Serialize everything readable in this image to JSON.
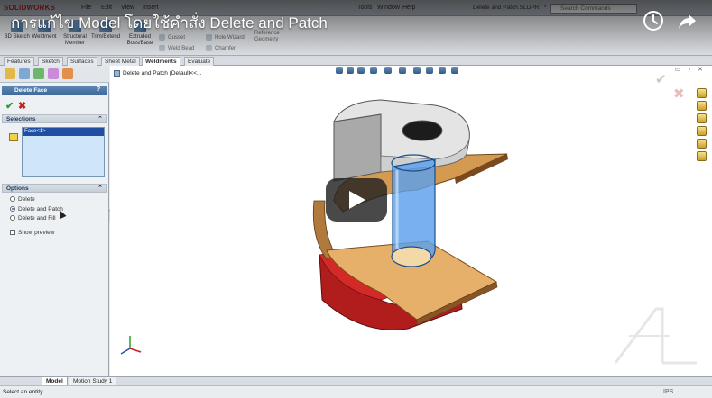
{
  "video": {
    "title": "การแก้ไข Model โดยใช้คำสั่ง Delete and Patch",
    "watch_later_icon": "clock-icon",
    "share_icon": "share-arrow-icon",
    "play_icon": "play-icon"
  },
  "app": {
    "logo": "SOLIDWORKS",
    "menu": [
      "File",
      "Edit",
      "View",
      "Insert",
      "Tools",
      "Window",
      "Help"
    ],
    "document_title": "Delete and Patch.SLDPRT *",
    "search_placeholder": "Search Commands"
  },
  "ribbon": {
    "buttons": [
      {
        "label": "3D Sketch",
        "icon": "sketch-icon"
      },
      {
        "label": "Weldment",
        "icon": "weldment-icon"
      },
      {
        "label": "Structural Member",
        "icon": "structural-member-icon"
      },
      {
        "label": "Trim/Extend",
        "icon": "trim-extend-icon"
      },
      {
        "label": "Extruded Boss/Base",
        "icon": "extrude-icon"
      }
    ],
    "small_items": [
      "Gusset",
      "Weld Bead",
      "Hole Wizard",
      "Chamfer"
    ],
    "reference_geometry": "Reference Geometry"
  },
  "command_tabs": [
    "Features",
    "Sketch",
    "Surfaces",
    "Sheet Metal",
    "Weldments",
    "Evaluate"
  ],
  "active_command_tab": "Weldments",
  "property_manager": {
    "title": "Delete Face",
    "help": "?",
    "ok": "✔",
    "cancel": "✖",
    "selections_header": "Selections",
    "selected_item": "Face<1>",
    "options_header": "Options",
    "options": [
      {
        "label": "Delete",
        "selected": false
      },
      {
        "label": "Delete and Patch",
        "selected": true
      },
      {
        "label": "Delete and Fill",
        "selected": false
      }
    ],
    "show_preview": "Show preview"
  },
  "viewport": {
    "tree_node": "Delete and Patch  (Default<<..."
  },
  "bottom_tabs": [
    "Model",
    "Motion Study 1"
  ],
  "active_bottom_tab": "Model",
  "status": {
    "message": "Select an entity",
    "right": "IPS"
  },
  "colors": {
    "model_top": "#d9a25a",
    "model_red": "#c0201f",
    "model_gray": "#bdbdbd",
    "selected_face": "#3d8de0",
    "pm_header": "#3d6796"
  }
}
